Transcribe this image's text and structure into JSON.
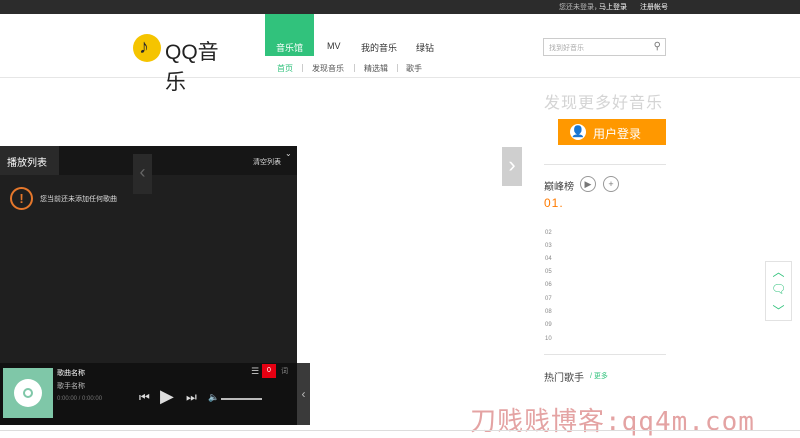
{
  "topbar": {
    "not_logged": "您还未登录，",
    "login_now": "马上登录",
    "register": "注册帐号"
  },
  "header": {
    "logo_text": "QQ音乐",
    "logo_glyph": "♪",
    "nav": [
      "音乐馆",
      "MV",
      "我的音乐",
      "绿钻"
    ],
    "subnav": [
      "首页",
      "发现音乐",
      "精选辑",
      "歌手"
    ],
    "search_placeholder": "找到好音乐",
    "search_icon": "⚲"
  },
  "sidebar": {
    "slogan": "发现更多好音乐",
    "login_label": "用户登录",
    "peak_title": "巅峰榜",
    "first_rank": "01.",
    "ranks": [
      "02",
      "03",
      "04",
      "05",
      "06",
      "07",
      "08",
      "09",
      "10"
    ],
    "hot_singers": "热门歌手",
    "more": "/ 更多"
  },
  "playlist": {
    "title": "播放列表",
    "clear": "清空列表",
    "close_icon": "⌄",
    "empty_message": "您当前还未添加任何歌曲"
  },
  "player": {
    "song_name": "歌曲名称",
    "singer_name": "歌手名称",
    "time": "0:00:00 / 0:00:00",
    "count": "0",
    "lyric": "词"
  },
  "watermark": "刀贱贱博客:qq4m.com",
  "colors": {
    "green": "#31c27c",
    "orange": "#ff9800",
    "dark": "#1f1f1f"
  }
}
